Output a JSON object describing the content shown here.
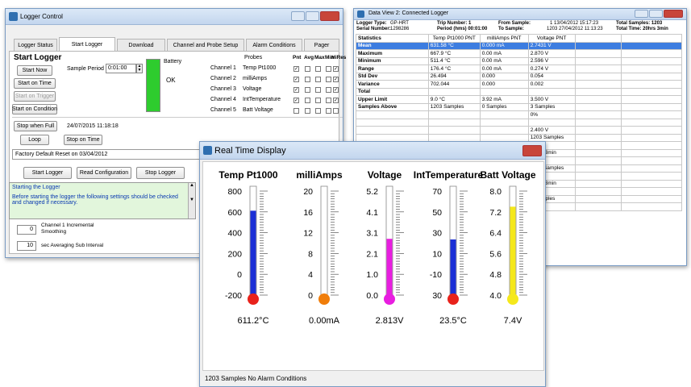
{
  "logger_control": {
    "title": "Logger Control",
    "tabs": [
      "Logger Status",
      "Start Logger",
      "Download",
      "Channel and Probe Setup",
      "Alarm Conditions",
      "Pager"
    ],
    "section_title": "Start Logger",
    "start_now": "Start Now",
    "start_on_time": "Start on Time",
    "start_on_trigger": "Start on Trigger",
    "start_on_condition": "Start on Condition",
    "sample_period_label": "Sample Period",
    "sample_period_value": "0:01:00",
    "battery_label": "Battery",
    "battery_status": "OK",
    "battery_color": "#2ecc2e",
    "probes_header": "Probes",
    "col_headers": [
      "Pnt",
      "Avg",
      "Max",
      "Min",
      "HiRes"
    ],
    "channels": [
      {
        "ch": "Channel 1",
        "probe": "Temp Pt1000",
        "checks": [
          true,
          false,
          false,
          false,
          true
        ]
      },
      {
        "ch": "Channel 2",
        "probe": "milliAmps",
        "checks": [
          true,
          false,
          false,
          false,
          true
        ]
      },
      {
        "ch": "Channel 3",
        "probe": "Voltage",
        "checks": [
          true,
          false,
          false,
          false,
          true
        ]
      },
      {
        "ch": "Channel 4",
        "probe": "IntTemperature",
        "checks": [
          true,
          false,
          false,
          false,
          true
        ]
      },
      {
        "ch": "Channel 5",
        "probe": "Batt Voltage",
        "checks": [
          false,
          false,
          false,
          false,
          false
        ]
      }
    ],
    "stop_when_full": "Stop when Full",
    "loop": "Loop",
    "stop_on_time": "Stop on Time",
    "stop_datetime": "24/07/2015 11:18:18",
    "reset_text": "Factory Default Reset on 03/04/2012",
    "start_logger_btn": "Start Logger",
    "read_config_btn": "Read Configuration",
    "stop_logger_btn": "Stop Logger",
    "log_line1": "Starting the Logger",
    "log_line2": "Before starting the logger the following settings should be checked",
    "log_line3": "and changed if necessary.",
    "smooth_value": "0",
    "smooth_label1": "Channel 1 Incremental",
    "smooth_label2": "Smoothing",
    "avg_value": "10",
    "avg_label": "sec Averaging Sub Interval"
  },
  "data_view": {
    "title": "Data View 2: Connected Logger",
    "logger_type_label": "Logger Type:",
    "logger_type_value": "GP-HRT",
    "serial_label": "Serial Number:",
    "serial_value": "1298286",
    "trip_label": "Trip Number: 1",
    "period_label": "Period (hms) 00:01:00",
    "from_label": "From Sample:",
    "from_value": "1 13/04/2012 15:17:23",
    "to_label": "To Sample:",
    "to_value": "1203 27/04/2012 11:13:23",
    "total_samples": "Total Samples: 1203",
    "total_time": "Total Time: 20hrs 3min",
    "headers": [
      "Statistics",
      "Temp Pt1000 PNT",
      "milliAmps PNT",
      "Voltage PNT"
    ],
    "rows": [
      {
        "label": "Mean",
        "v": [
          "631.58 °C",
          "0.000 mA",
          "2.7431 V"
        ],
        "sel": true
      },
      {
        "label": "Maximum",
        "v": [
          "667.9 °C",
          "0.00 mA",
          "2.870 V"
        ]
      },
      {
        "label": "Minimum",
        "v": [
          "511.4 °C",
          "0.00 mA",
          "2.596 V"
        ]
      },
      {
        "label": "Range",
        "v": [
          "176.4 °C",
          "0.00 mA",
          "0.274 V"
        ]
      },
      {
        "label": "Std Dev",
        "v": [
          "26.494",
          "0.000",
          "0.054"
        ]
      },
      {
        "label": "Variance",
        "v": [
          "702.044",
          "0.000",
          "0.002"
        ]
      },
      {
        "label": "Total",
        "v": [
          "",
          "",
          ""
        ]
      },
      {
        "label": "Upper Limit",
        "v": [
          "9.0 °C",
          "3.92 mA",
          "3.500 V"
        ]
      },
      {
        "label": "Samples Above",
        "v": [
          "1203 Samples",
          "0 Samples",
          "3 Samples"
        ]
      },
      {
        "label": "",
        "v": [
          "",
          "",
          "0%"
        ]
      },
      {
        "label": "",
        "v": [
          "",
          "",
          ""
        ]
      },
      {
        "label": "",
        "v": [
          "",
          "",
          "2.400 V"
        ]
      },
      {
        "label": "",
        "v": [
          "",
          "",
          "1203 Samples"
        ]
      },
      {
        "label": "",
        "v": [
          "",
          "",
          "100%"
        ]
      },
      {
        "label": "",
        "v": [
          "",
          "",
          "20hrs 3min"
        ]
      },
      {
        "label": "",
        "v": [
          "",
          "",
          ""
        ]
      },
      {
        "label": "",
        "v": [
          "",
          "",
          "1203 Samples"
        ]
      },
      {
        "label": "",
        "v": [
          "",
          "",
          "100%"
        ]
      },
      {
        "label": "",
        "v": [
          "",
          "",
          "20hrs 3min"
        ]
      },
      {
        "label": "",
        "v": [
          "",
          "",
          ""
        ]
      },
      {
        "label": "",
        "v": [
          "",
          "",
          "0 Samples"
        ]
      },
      {
        "label": "",
        "v": [
          "",
          "",
          "0%"
        ]
      }
    ]
  },
  "realtime": {
    "title": "Real Time Display",
    "status": "1203 Samples  No Alarm Conditions",
    "gauges": [
      {
        "title": "Temp Pt1000",
        "ticks": [
          "800",
          "600",
          "400",
          "200",
          "0",
          "-200"
        ],
        "min": -200,
        "max": 800,
        "value": 611.2,
        "reading": "611.2°C",
        "color": "#1b2fd6",
        "bulb": "#e8221b"
      },
      {
        "title": "milliAmps",
        "ticks": [
          "20",
          "16",
          "12",
          "8",
          "4",
          "0"
        ],
        "min": 0,
        "max": 20,
        "value": 0.0,
        "reading": "0.00mA",
        "color": "#1b2fd6",
        "bulb": "#f07d0a"
      },
      {
        "title": "Voltage",
        "ticks": [
          "5.2",
          "4.1",
          "3.1",
          "2.1",
          "1.0",
          "0.0"
        ],
        "min": 0,
        "max": 5.2,
        "value": 2.813,
        "reading": "2.813V",
        "color": "#e81ee0",
        "bulb": "#e81ee0"
      },
      {
        "title": "IntTemperature",
        "ticks": [
          "70",
          "50",
          "30",
          "10",
          "-10",
          "30"
        ],
        "min": -30,
        "max": 70,
        "value": 23.5,
        "reading": "23.5°C",
        "color": "#1b2fd6",
        "bulb": "#e8221b"
      },
      {
        "title": "Batt Voltage",
        "ticks": [
          "8.0",
          "7.2",
          "6.4",
          "5.6",
          "4.8",
          "4.0"
        ],
        "min": 4,
        "max": 8,
        "value": 7.4,
        "reading": "7.4V",
        "color": "#f5e81b",
        "bulb": "#f5e81b"
      }
    ]
  }
}
